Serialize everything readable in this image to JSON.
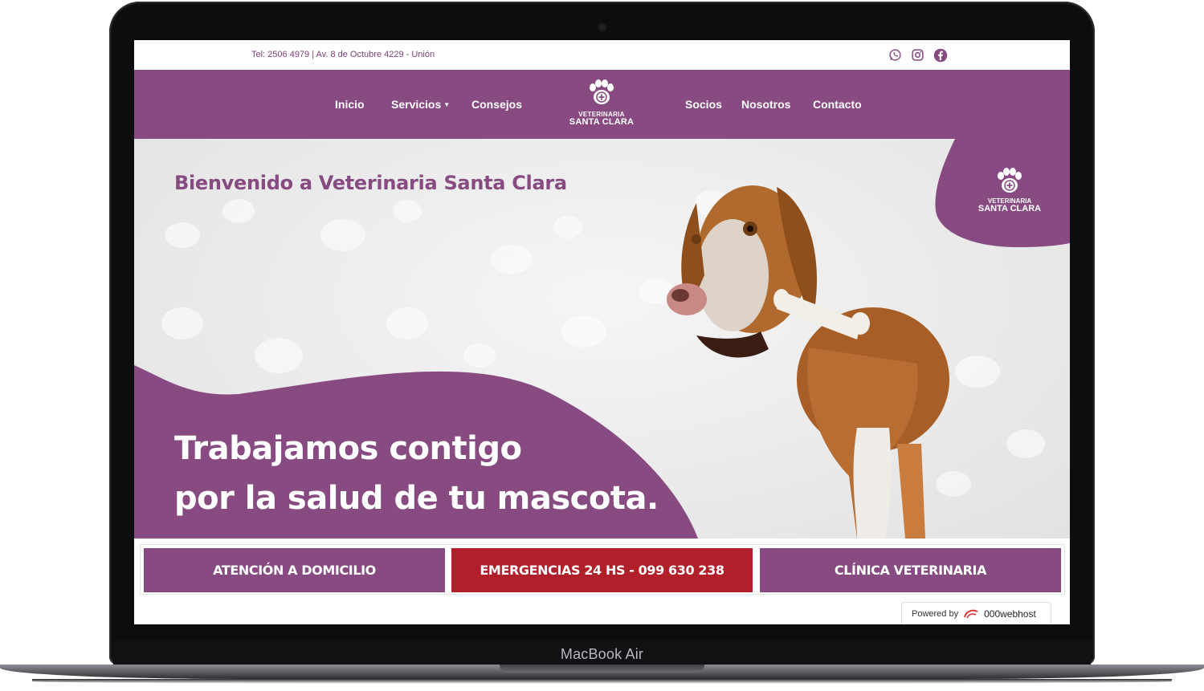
{
  "device": {
    "label": "MacBook Air"
  },
  "topbar": {
    "info": "Tel: 2506 4979 | Av. 8 de Octubre 4229 - Unión",
    "social_icons": [
      "whatsapp-icon",
      "instagram-icon",
      "facebook-icon"
    ]
  },
  "nav": {
    "items": [
      "Inicio",
      "Servicios",
      "Consejos",
      "Socios",
      "Nosotros",
      "Contacto"
    ],
    "logo_line1": "VETERINARIA",
    "logo_line2": "SANTA CLARA"
  },
  "hero": {
    "welcome": "Bienvenido a Veterinaria Santa Clara",
    "slogan_line1": "Trabajamos contigo",
    "slogan_line2": "por la salud de tu mascota.",
    "prev_arrow": "‹",
    "next_arrow": "›"
  },
  "buttons": [
    "ATENCIÓN A DOMICILIO",
    "EMERGENCIAS 24 HS - 099 630 238",
    "CLÍNICA VETERINARIA"
  ],
  "powered": {
    "label": "Powered by",
    "host": "000webhost"
  },
  "colors": {
    "brand": "#874b82",
    "emergency": "#b1202a"
  }
}
